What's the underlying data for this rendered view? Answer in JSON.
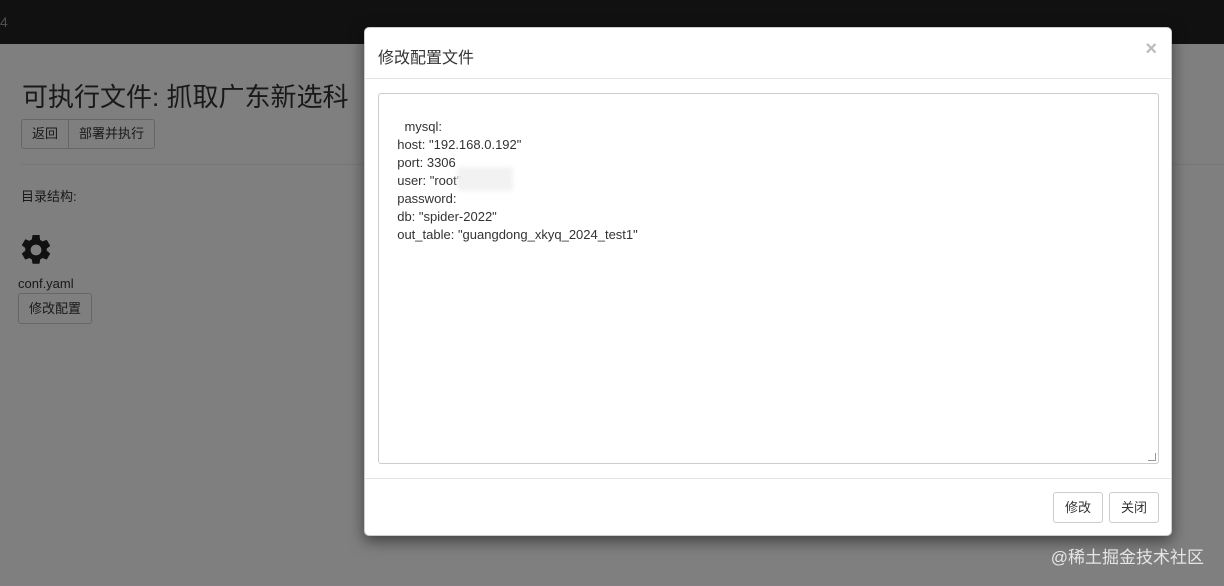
{
  "navbar": {
    "brand_fragment": "4"
  },
  "page": {
    "title": "可执行文件: 抓取广东新选科",
    "back_button": "返回",
    "deploy_button": "部署并执行",
    "directory_label": "目录结构:",
    "file": {
      "icon": "gear-icon",
      "name": "conf.yaml",
      "edit_button": "修改配置"
    }
  },
  "modal": {
    "title": "修改配置文件",
    "close_symbol": "×",
    "config_text": "mysql:\n  host: \"192.168.0.192\"\n  port: 3306\n  user: \"root\"\n  password: \n  db: \"spider-2022\"\n  out_table: \"guangdong_xkyq_2024_test1\"",
    "modify_button": "修改",
    "close_button": "关闭"
  },
  "watermark": "@稀土掘金技术社区"
}
